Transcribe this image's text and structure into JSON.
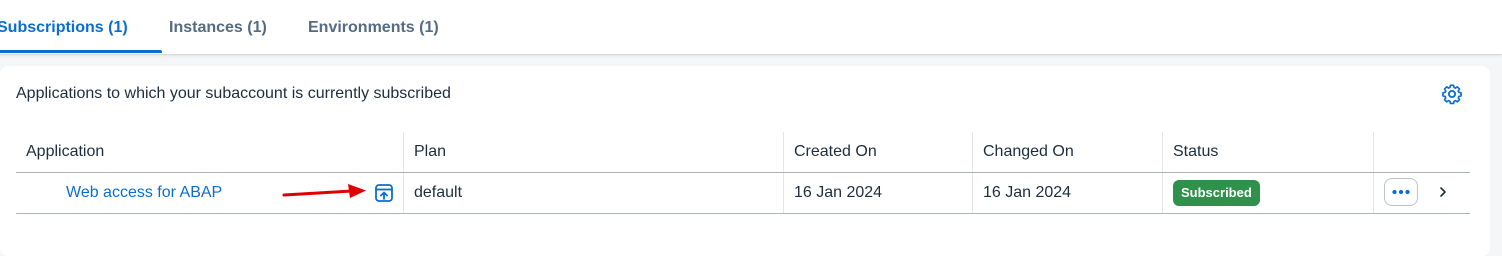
{
  "tabs": [
    {
      "label": "Subscriptions (1)",
      "active": true
    },
    {
      "label": "Instances (1)",
      "active": false
    },
    {
      "label": "Environments (1)",
      "active": false
    }
  ],
  "card": {
    "title": "Applications to which your subaccount is currently subscribed",
    "settings_icon": "gear-icon"
  },
  "table": {
    "columns": [
      "Application",
      "Plan",
      "Created On",
      "Changed On",
      "Status",
      ""
    ],
    "rows": [
      {
        "application": "Web access for ABAP",
        "launch_icon": "launch-icon",
        "plan": "default",
        "created_on": "16 Jan 2024",
        "changed_on": "16 Jan 2024",
        "status": "Subscribed",
        "actions_icon": "more-icon",
        "nav_icon": "chevron-right-icon"
      }
    ]
  },
  "annotation": {
    "type": "red-arrow",
    "color": "#e00000"
  },
  "colors": {
    "accent": "#0a6ed1",
    "status_success": "#30914c",
    "text": "#1d2d3e",
    "muted_tab": "#556b82"
  }
}
